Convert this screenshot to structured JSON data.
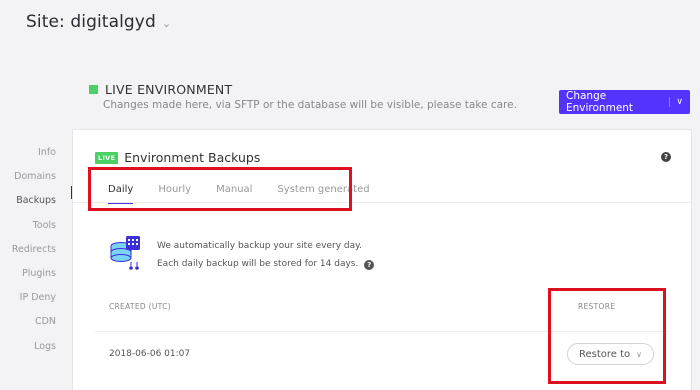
{
  "header": {
    "site_label": "Site: digitalgyd"
  },
  "environment": {
    "title": "LIVE ENVIRONMENT",
    "subtitle": "Changes made here, via SFTP or the database will be visible, please take care.",
    "change_button": "Change Environment"
  },
  "sidebar": {
    "items": [
      {
        "label": "Info"
      },
      {
        "label": "Domains"
      },
      {
        "label": "Backups"
      },
      {
        "label": "Tools"
      },
      {
        "label": "Redirects"
      },
      {
        "label": "Plugins"
      },
      {
        "label": "IP Deny"
      },
      {
        "label": "CDN"
      },
      {
        "label": "Logs"
      }
    ],
    "active": "Backups"
  },
  "card": {
    "badge": "LIVE",
    "title": "Environment Backups",
    "tabs": [
      "Daily",
      "Hourly",
      "Manual",
      "System generated"
    ],
    "active_tab": "Daily",
    "info_line_1": "We automatically backup your site every day.",
    "info_line_2": "Each daily backup will be stored for 14 days.",
    "columns": {
      "created": "CREATED (UTC)",
      "restore": "RESTORE"
    },
    "rows": [
      {
        "created": "2018-06-06 01:07",
        "action": "Restore to"
      }
    ]
  },
  "colors": {
    "accent": "#5533ff",
    "live_green": "#4cd066",
    "highlight_red": "#e01020"
  }
}
